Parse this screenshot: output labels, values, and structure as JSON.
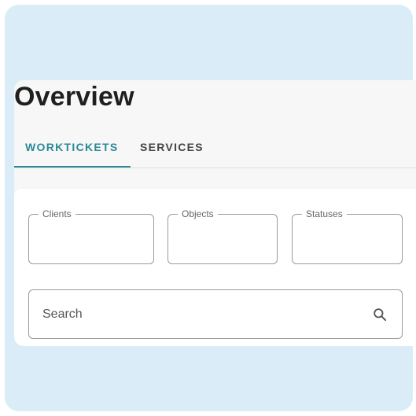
{
  "page": {
    "title": "Overview"
  },
  "tabs": [
    {
      "label": "WORKTICKETS",
      "active": true
    },
    {
      "label": "SERVICES",
      "active": false
    }
  ],
  "filters": {
    "clients": {
      "label": "Clients",
      "value": ""
    },
    "objects": {
      "label": "Objects",
      "value": ""
    },
    "statuses": {
      "label": "Statuses",
      "value": ""
    }
  },
  "search": {
    "placeholder": "Search",
    "value": "",
    "icon": "search-icon"
  },
  "colors": {
    "background": "#d9ecf7",
    "accent": "#2a8a96",
    "border": "#9a9a9a"
  }
}
